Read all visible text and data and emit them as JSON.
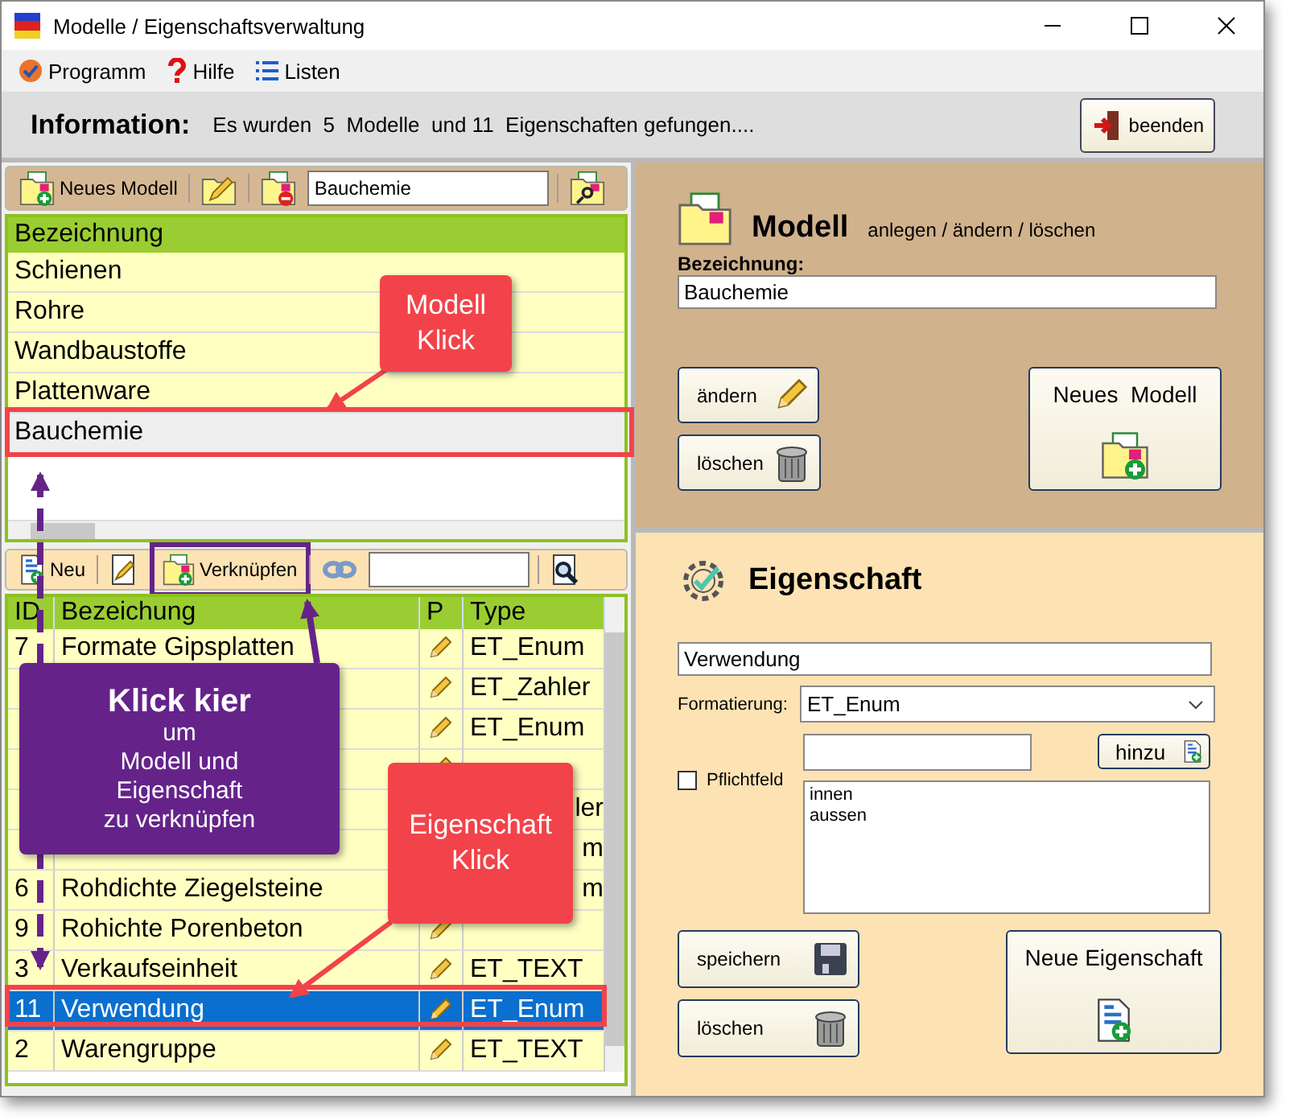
{
  "window": {
    "title": "Modelle / Eigenschaftsverwaltung"
  },
  "menu": [
    {
      "label": "Programm",
      "kind": "program"
    },
    {
      "label": "Hilfe",
      "kind": "help"
    },
    {
      "label": "Listen",
      "kind": "list"
    }
  ],
  "info": {
    "label": "Information:",
    "text": "Es wurden  5  Modelle  und 11  Eigenschaften gefungen....",
    "exit_button": "beenden"
  },
  "models": {
    "toolbar": {
      "new_label": "Neues Modell",
      "search_value": "Bauchemie"
    },
    "column": "Bezeichnung",
    "rows": [
      {
        "label": "Schienen",
        "selected": false
      },
      {
        "label": "Rohre",
        "selected": false
      },
      {
        "label": "Wandbaustoffe",
        "selected": false
      },
      {
        "label": "Plattenware",
        "selected": false
      },
      {
        "label": "Bauchemie",
        "selected": true
      }
    ]
  },
  "properties": {
    "toolbar": {
      "new_label": "Neu",
      "link_label": "Verknüpfen"
    },
    "columns": [
      "ID",
      "Bezeichung",
      "P",
      "Type"
    ],
    "rows": [
      {
        "id": "7",
        "name": "Formate Gipsplatten",
        "type": "ET_Enum",
        "selected": false
      },
      {
        "type": "ET_Zahler",
        "selected": false
      },
      {
        "type": "ET_Enum",
        "selected": false
      },
      {
        "selected": false
      },
      {
        "type": "ler",
        "type_cut": true,
        "selected": false
      },
      {
        "type": "m",
        "type_cut": true,
        "selected": false
      },
      {
        "id": "6",
        "name": "Rohdichte Ziegelsteine",
        "type": "m",
        "type_cut": true,
        "selected": false
      },
      {
        "id": "9",
        "name": "Rohichte Porenbeton",
        "selected": false
      },
      {
        "id": "3",
        "name": "Verkaufseinheit",
        "type": "ET_TEXT",
        "selected": false
      },
      {
        "id": "11",
        "name": "Verwendung",
        "type": "ET_Enum",
        "selected": true
      },
      {
        "id": "2",
        "name": "Warengruppe",
        "type": "ET_TEXT",
        "selected": false
      }
    ]
  },
  "model_panel": {
    "title": "Modell",
    "subtitle": "anlegen / ändern / löschen",
    "field_label": "Bezeichnung:",
    "field_value": "Bauchemie",
    "edit_button": "ändern",
    "delete_button": "löschen",
    "new_button": "Neues  Modell"
  },
  "property_panel": {
    "title": "Eigenschaft",
    "name_value": "Verwendung",
    "format_label": "Formatierung:",
    "format_value": "ET_Enum",
    "add_button": "hinzu",
    "required": {
      "label": "Pflichtfeld",
      "checked": false
    },
    "values": [
      "innen",
      "aussen"
    ],
    "save_button": "speichern",
    "delete_button": "löschen",
    "new_button": "Neue Eigenschaft"
  },
  "annotations": [
    {
      "kind": "note",
      "heading": "Modell",
      "text": "Klick",
      "color": "#f2434a"
    },
    {
      "kind": "note",
      "heading": "Klick kier",
      "text": "um\nModell und\nEigenschaft\nzu verknüpfen",
      "color": "#65238a"
    },
    {
      "kind": "note",
      "heading": "Eigenschaft",
      "text": "Klick",
      "color": "#f2434a"
    }
  ]
}
